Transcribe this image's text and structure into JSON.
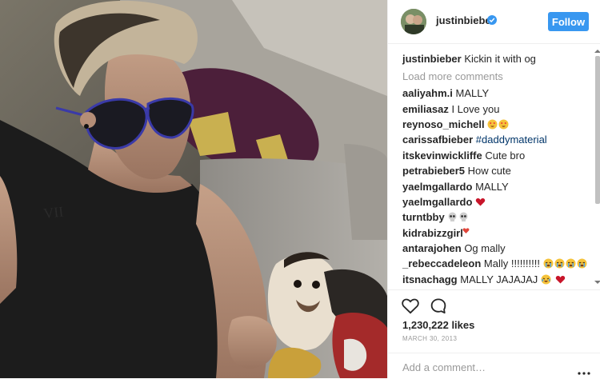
{
  "post": {
    "username": "justinbieber",
    "follow_label": "Follow",
    "caption_user": "justinbieber",
    "caption_text": "Kickin it with og",
    "load_more": "Load more comments",
    "likes": "1,230,222 likes",
    "date": "MARCH 30, 2013",
    "add_comment_placeholder": "Add a comment…"
  },
  "comments": [
    {
      "user": "aaliyahm.i",
      "text": "MALLY"
    },
    {
      "user": "emiliasaz",
      "text": "I Love you"
    },
    {
      "user": "reynoso_michell",
      "text": ""
    },
    {
      "user": "carissafbieber",
      "text": "#daddymaterial"
    },
    {
      "user": "itskevinwickliffe",
      "text": "Cute bro"
    },
    {
      "user": "petrabieber5",
      "text": "How cute"
    },
    {
      "user": "yaelmgallardo",
      "text": "MALLY"
    },
    {
      "user": "yaelmgallardo",
      "text": ""
    },
    {
      "user": "turntbby",
      "text": ""
    },
    {
      "user": "kidrabizzgirl",
      "text": ""
    },
    {
      "user": "antarajohen",
      "text": "Og mally"
    },
    {
      "user": "_rebeccadeleon",
      "text": "Mally !!!!!!!!!!"
    },
    {
      "user": "itsnachagg",
      "text": "MALLY JAJAJAJ"
    }
  ],
  "icons": {
    "verified": "verified-badge-icon",
    "like": "heart-icon",
    "comment": "comment-bubble-icon",
    "more": "more-options-icon"
  },
  "colors": {
    "accent": "#3897f0",
    "hashtag": "#003569",
    "muted": "#999999"
  }
}
